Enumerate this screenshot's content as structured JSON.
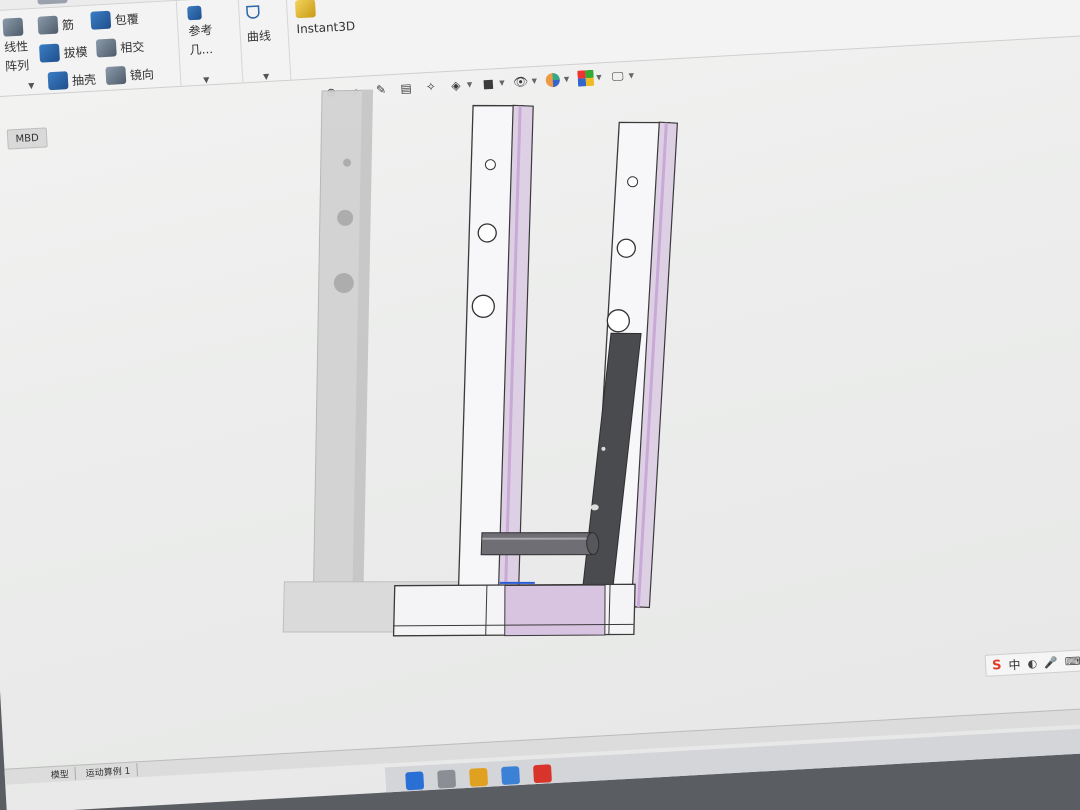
{
  "ribbon": {
    "linear_pattern_label_1": "线性",
    "linear_pattern_label_2": "阵列",
    "rib_label": "筋",
    "wrap_label": "包覆",
    "draft_label": "拔模",
    "intersect_label": "相交",
    "shell_label": "抽壳",
    "mirror_label": "镜向",
    "reference_label_1": "参考",
    "reference_label_2": "几...",
    "curves_label": "曲线",
    "instant3d_label": "Instant3D"
  },
  "tabs": {
    "mbd_label": "MBD"
  },
  "bottom_tabs": [
    {
      "label": "模型"
    },
    {
      "label": "运动算例 1"
    }
  ],
  "tray": {
    "ime_brand": "S",
    "ime_lang": "中"
  },
  "colors": {
    "part_face": "#f7f6f8",
    "part_edge": "#3a3a3a",
    "accent_purple": "#c9a9d6",
    "dark_plate": "#4a4b4e",
    "ghost_part": "#c9c9c9"
  },
  "icons": [
    "undo-icon",
    "select-icon",
    "traffic-light-icon",
    "file-properties-icon",
    "options-gear-icon"
  ]
}
